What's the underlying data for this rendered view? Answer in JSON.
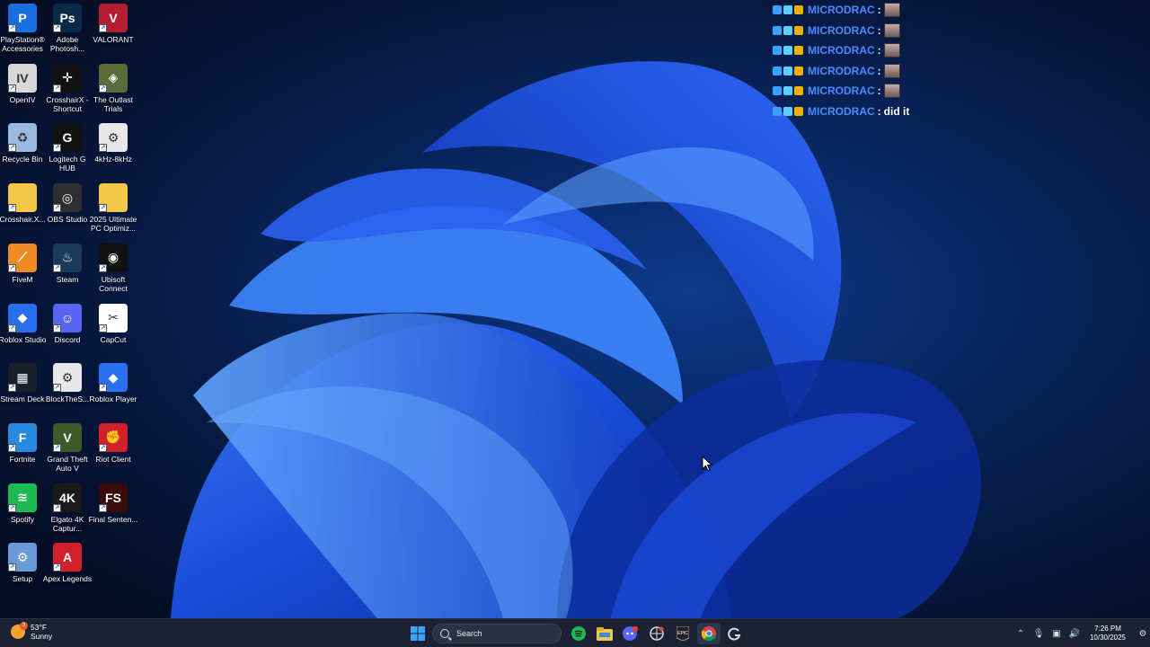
{
  "desktop": {
    "icons": [
      {
        "label": "PlayStation® Accessories",
        "icon": "playstation-icon",
        "color": "#1a6fe0"
      },
      {
        "label": "Adobe Photosh...",
        "icon": "photoshop-icon",
        "color": "#0a2a4a"
      },
      {
        "label": "VALORANT",
        "icon": "valorant-icon",
        "color": "#b21f30"
      },
      {
        "label": "OpenIV",
        "icon": "openiv-icon",
        "color": "#d8d8d8"
      },
      {
        "label": "CrosshairX - Shortcut",
        "icon": "crosshairx-icon",
        "color": "#111111"
      },
      {
        "label": "The Outlast Trials",
        "icon": "outlast-icon",
        "color": "#5a6a3a"
      },
      {
        "label": "Recycle Bin",
        "icon": "recycle-bin-icon",
        "color": "#9ab8e0"
      },
      {
        "label": "Logitech G HUB",
        "icon": "logitech-icon",
        "color": "#111111"
      },
      {
        "label": "4kHz-8kHz",
        "icon": "settings-file-icon",
        "color": "#e8e8e8"
      },
      {
        "label": "Crosshair.X...",
        "icon": "folder-icon",
        "color": "#f3c84a"
      },
      {
        "label": "OBS Studio",
        "icon": "obs-icon",
        "color": "#302e31"
      },
      {
        "label": "2025 Ultimate PC Optimiz...",
        "icon": "folder-icon",
        "color": "#f3c84a"
      },
      {
        "label": "FiveM",
        "icon": "fivem-icon",
        "color": "#f08a24"
      },
      {
        "label": "Steam",
        "icon": "steam-icon",
        "color": "#1b3a5c"
      },
      {
        "label": "Ubisoft Connect",
        "icon": "ubisoft-icon",
        "color": "#111111"
      },
      {
        "label": "Roblox Studio",
        "icon": "roblox-studio-icon",
        "color": "#2a6ff0"
      },
      {
        "label": "Discord",
        "icon": "discord-icon",
        "color": "#5865f2"
      },
      {
        "label": "CapCut",
        "icon": "capcut-icon",
        "color": "#ffffff"
      },
      {
        "label": "Stream Deck",
        "icon": "stream-deck-icon",
        "color": "#1b1f2a"
      },
      {
        "label": "BlockTheS...",
        "icon": "settings-file-icon",
        "color": "#e8e8e8"
      },
      {
        "label": "Roblox Player",
        "icon": "roblox-icon",
        "color": "#2a6ff0"
      },
      {
        "label": "Fortnite",
        "icon": "fortnite-icon",
        "color": "#2a8ae0"
      },
      {
        "label": "Grand Theft Auto V",
        "icon": "gta-icon",
        "color": "#3a5a2a"
      },
      {
        "label": "Riot Client",
        "icon": "riot-icon",
        "color": "#d1202a"
      },
      {
        "label": "Spotify",
        "icon": "spotify-icon",
        "color": "#1db954"
      },
      {
        "label": "Elgato 4K Captur...",
        "icon": "elgato-icon",
        "color": "#1a1a1a"
      },
      {
        "label": "Final Senten...",
        "icon": "final-sentence-icon",
        "color": "#3a0a0a"
      },
      {
        "label": "Setup",
        "icon": "setup-icon",
        "color": "#6a9ad8"
      },
      {
        "label": "Apex Legends",
        "icon": "apex-icon",
        "color": "#d1202a"
      }
    ]
  },
  "chat": {
    "lines": [
      {
        "user": "MICRODRAC",
        "sep": ":",
        "msg": "",
        "emote": true
      },
      {
        "user": "MICRODRAC",
        "sep": ":",
        "msg": "",
        "emote": true
      },
      {
        "user": "MICRODRAC",
        "sep": ":",
        "msg": "",
        "emote": true
      },
      {
        "user": "MICRODRAC",
        "sep": ":",
        "msg": "",
        "emote": true
      },
      {
        "user": "MICRODRAC",
        "sep": ":",
        "msg": "",
        "emote": true
      },
      {
        "user": "MICRODRAC",
        "sep": ":",
        "msg": "did it",
        "emote": false
      }
    ]
  },
  "taskbar": {
    "weather_temp": "53°F",
    "weather_cond": "Sunny",
    "weather_alert": "3",
    "search_placeholder": "Search",
    "apps": [
      "start-icon",
      "spotify-icon",
      "file-explorer-icon",
      "discord-icon",
      "crosshair-app-icon",
      "epic-games-icon",
      "chrome-icon",
      "logitech-icon"
    ],
    "time": "7:26 PM",
    "date": "10/30/2025"
  }
}
